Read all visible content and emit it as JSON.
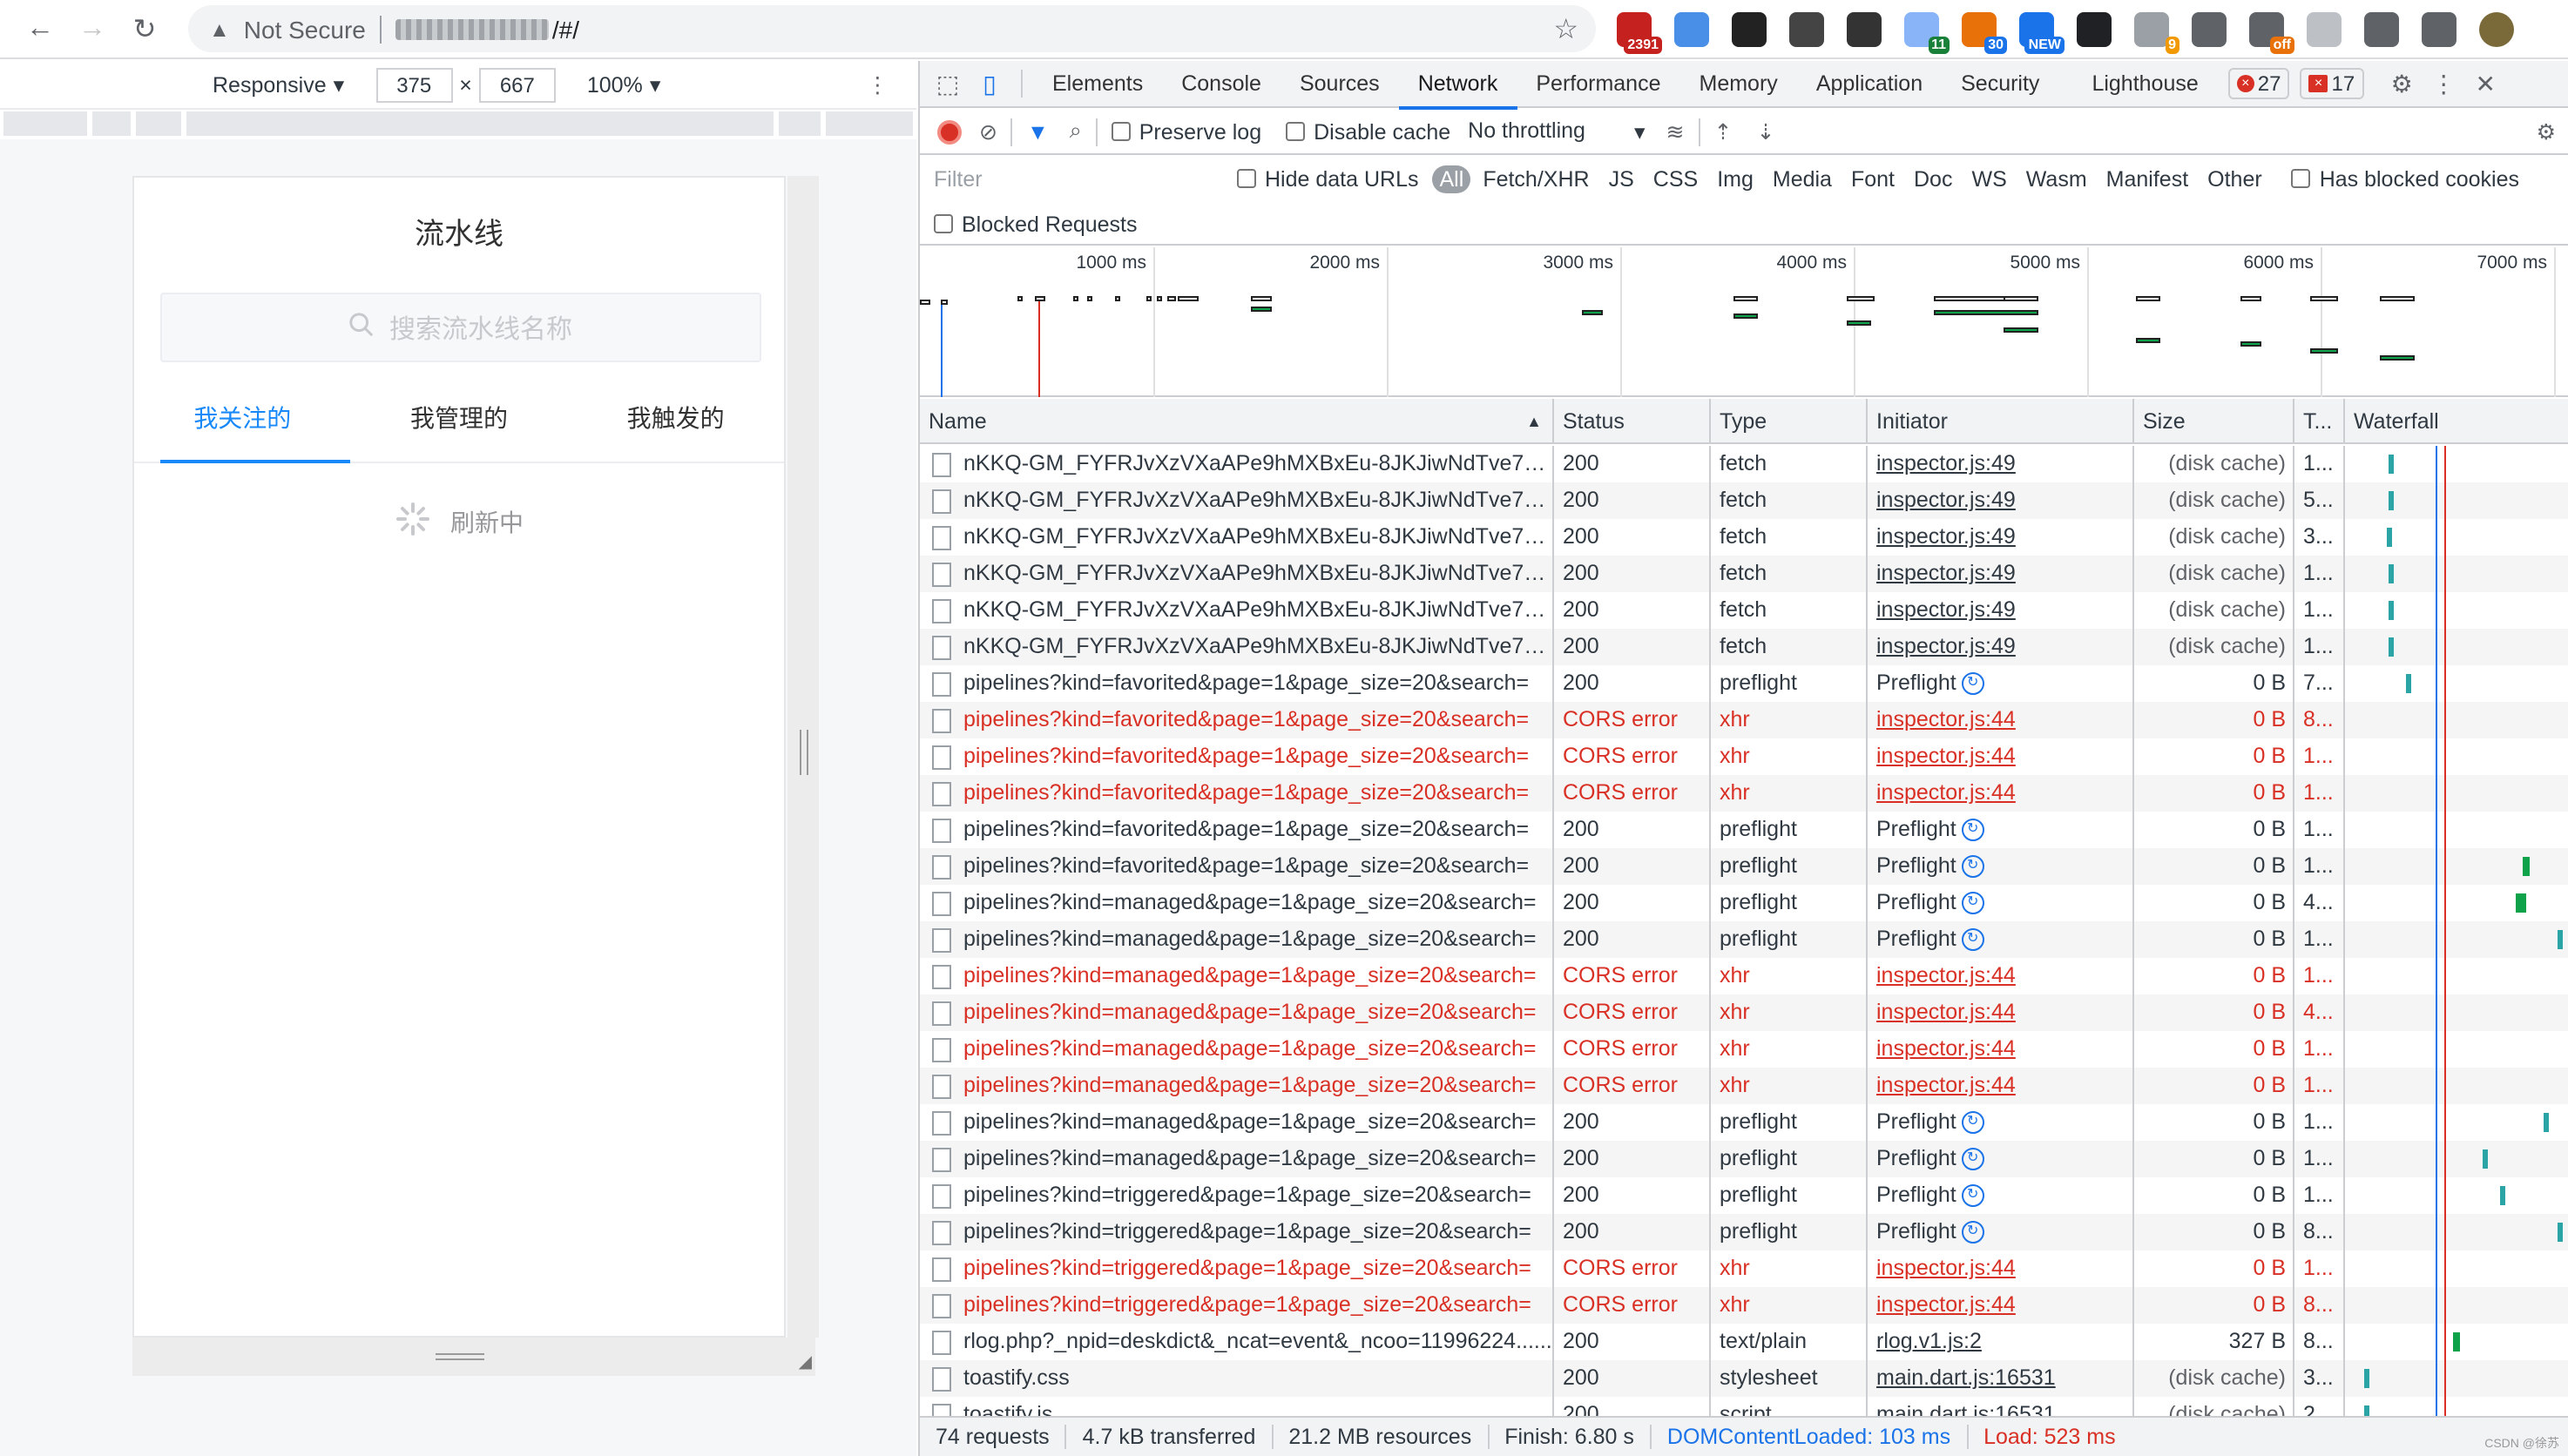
{
  "browser": {
    "security_label": "Not Secure",
    "url_suffix": "/#/",
    "extensions": [
      {
        "name": "gmail-ext-icon",
        "color": "#c5221f",
        "badge": "2391",
        "badge_color": "#c5221f"
      },
      {
        "name": "safari-ext-icon",
        "color": "#4a8fe7",
        "badge": ""
      },
      {
        "name": "spy-ext-icon",
        "color": "#222222",
        "badge": ""
      },
      {
        "name": "h1-ext-icon",
        "color": "#444444",
        "badge": ""
      },
      {
        "name": "square-ext-icon",
        "color": "#333333",
        "badge": ""
      },
      {
        "name": "copy-ext-icon",
        "color": "#8ab4f8",
        "badge": "11",
        "badge_color": "#188038"
      },
      {
        "name": "tile-ext-icon",
        "color": "#e8710a",
        "badge": "30",
        "badge_color": "#1a73e8"
      },
      {
        "name": "new-ext-icon",
        "color": "#1a73e8",
        "badge": "NEW",
        "badge_color": "#1a73e8"
      },
      {
        "name": "mask-ext-icon",
        "color": "#202124",
        "badge": ""
      },
      {
        "name": "circle-ext-icon",
        "color": "#9aa0a6",
        "badge": "9",
        "badge_color": "#f29900"
      },
      {
        "name": "globe-ext-icon",
        "color": "#5f6368",
        "badge": ""
      },
      {
        "name": "off-ext-icon",
        "color": "#5f6368",
        "badge": "off",
        "badge_color": "#e8710a"
      },
      {
        "name": "a-ext-icon",
        "color": "#bdc1c6",
        "badge": ""
      },
      {
        "name": "bracket-ext-icon",
        "color": "#5f6368",
        "badge": ""
      },
      {
        "name": "puzzle-ext-icon",
        "color": "#5f6368",
        "badge": ""
      },
      {
        "name": "profile-avatar-icon",
        "color": "#7a6a3a",
        "badge": ""
      }
    ]
  },
  "device": {
    "mode": "Responsive",
    "width": "375",
    "height": "667",
    "times": "×",
    "zoom": "100%"
  },
  "app": {
    "title": "流水线",
    "search_placeholder": "搜索流水线名称",
    "tabs": [
      "我关注的",
      "我管理的",
      "我触发的"
    ],
    "active_tab": 0,
    "loading_text": "刷新中"
  },
  "devtools": {
    "tabs": [
      "Elements",
      "Console",
      "Sources",
      "Network",
      "Performance",
      "Memory",
      "Application",
      "Security",
      "Lighthouse"
    ],
    "active_tab": "Network",
    "error_count": "27",
    "warning_count": "17",
    "toolbar": {
      "preserve_log": "Preserve log",
      "disable_cache": "Disable cache",
      "throttling": "No throttling"
    },
    "filter": {
      "placeholder": "Filter",
      "hide_data_urls": "Hide data URLs",
      "types": [
        "All",
        "Fetch/XHR",
        "JS",
        "CSS",
        "Img",
        "Media",
        "Font",
        "Doc",
        "WS",
        "Wasm",
        "Manifest",
        "Other"
      ],
      "has_blocked_cookies": "Has blocked cookies",
      "blocked_requests": "Blocked Requests"
    },
    "overview_ticks": [
      "1000 ms",
      "2000 ms",
      "3000 ms",
      "4000 ms",
      "5000 ms",
      "6000 ms",
      "7000 ms"
    ],
    "columns": [
      "Name",
      "Status",
      "Type",
      "Initiator",
      "Size",
      "T...",
      "Waterfall"
    ],
    "rows": [
      {
        "name": "nKKQ-GM_FYFRJvXzVXaAPe9hMXBxEu-8JKJiwNdTve7W4...",
        "status": "200",
        "type": "fetch",
        "initiator": "inspector.js:49",
        "init_kind": "link",
        "size": "(disk cache)",
        "time": "1...",
        "err": false,
        "wf": [
          {
            "pos": 0.2,
            "kind": "t"
          }
        ]
      },
      {
        "name": "nKKQ-GM_FYFRJvXzVXaAPe9hMXBxEu-8JKJiwNdTve7W4...",
        "status": "200",
        "type": "fetch",
        "initiator": "inspector.js:49",
        "init_kind": "link",
        "size": "(disk cache)",
        "time": "5...",
        "err": false,
        "wf": [
          {
            "pos": 0.2,
            "kind": "t"
          }
        ]
      },
      {
        "name": "nKKQ-GM_FYFRJvXzVXaAPe9hMXBxEu-8JKJiwNdTve7W4...",
        "status": "200",
        "type": "fetch",
        "initiator": "inspector.js:49",
        "init_kind": "link",
        "size": "(disk cache)",
        "time": "3...",
        "err": false,
        "wf": [
          {
            "pos": 0.19,
            "kind": "t"
          }
        ]
      },
      {
        "name": "nKKQ-GM_FYFRJvXzVXaAPe9hMXBxEu-8JKJiwNdTve7W4...",
        "status": "200",
        "type": "fetch",
        "initiator": "inspector.js:49",
        "init_kind": "link",
        "size": "(disk cache)",
        "time": "1...",
        "err": false,
        "wf": [
          {
            "pos": 0.2,
            "kind": "t"
          }
        ]
      },
      {
        "name": "nKKQ-GM_FYFRJvXzVXaAPe9hMXBxEu-8JKJiwNdTve7W4...",
        "status": "200",
        "type": "fetch",
        "initiator": "inspector.js:49",
        "init_kind": "link",
        "size": "(disk cache)",
        "time": "1...",
        "err": false,
        "wf": [
          {
            "pos": 0.2,
            "kind": "t"
          }
        ]
      },
      {
        "name": "nKKQ-GM_FYFRJvXzVXaAPe9hMXBxEu-8JKJiwNdTve7W4...",
        "status": "200",
        "type": "fetch",
        "initiator": "inspector.js:49",
        "init_kind": "link",
        "size": "(disk cache)",
        "time": "1...",
        "err": false,
        "wf": [
          {
            "pos": 0.2,
            "kind": "t"
          }
        ]
      },
      {
        "name": "pipelines?kind=favorited&page=1&page_size=20&search=",
        "status": "200",
        "type": "preflight",
        "initiator": "Preflight",
        "init_kind": "preflight",
        "size": "0 B",
        "time": "7...",
        "err": false,
        "wf": [
          {
            "pos": 0.28,
            "kind": "t"
          }
        ]
      },
      {
        "name": "pipelines?kind=favorited&page=1&page_size=20&search=",
        "status": "CORS error",
        "type": "xhr",
        "initiator": "inspector.js:44",
        "init_kind": "link",
        "size": "0 B",
        "time": "8...",
        "err": true,
        "wf": []
      },
      {
        "name": "pipelines?kind=favorited&page=1&page_size=20&search=",
        "status": "CORS error",
        "type": "xhr",
        "initiator": "inspector.js:44",
        "init_kind": "link",
        "size": "0 B",
        "time": "1...",
        "err": true,
        "wf": []
      },
      {
        "name": "pipelines?kind=favorited&page=1&page_size=20&search=",
        "status": "CORS error",
        "type": "xhr",
        "initiator": "inspector.js:44",
        "init_kind": "link",
        "size": "0 B",
        "time": "1...",
        "err": true,
        "wf": []
      },
      {
        "name": "pipelines?kind=favorited&page=1&page_size=20&search=",
        "status": "200",
        "type": "preflight",
        "initiator": "Preflight",
        "init_kind": "preflight",
        "size": "0 B",
        "time": "1...",
        "err": false,
        "wf": []
      },
      {
        "name": "pipelines?kind=favorited&page=1&page_size=20&search=",
        "status": "200",
        "type": "preflight",
        "initiator": "Preflight",
        "init_kind": "preflight",
        "size": "0 B",
        "time": "1...",
        "err": false,
        "wf": [
          {
            "pos": 0.82,
            "kind": "g"
          }
        ]
      },
      {
        "name": "pipelines?kind=managed&page=1&page_size=20&search=",
        "status": "200",
        "type": "preflight",
        "initiator": "Preflight",
        "init_kind": "preflight",
        "size": "0 B",
        "time": "4...",
        "err": false,
        "wf": [
          {
            "pos": 0.79,
            "kind": "g"
          },
          {
            "pos": 0.81,
            "kind": "g"
          }
        ]
      },
      {
        "name": "pipelines?kind=managed&page=1&page_size=20&search=",
        "status": "200",
        "type": "preflight",
        "initiator": "Preflight",
        "init_kind": "preflight",
        "size": "0 B",
        "time": "1...",
        "err": false,
        "wf": [
          {
            "pos": 0.98,
            "kind": "t"
          }
        ]
      },
      {
        "name": "pipelines?kind=managed&page=1&page_size=20&search=",
        "status": "CORS error",
        "type": "xhr",
        "initiator": "inspector.js:44",
        "init_kind": "link",
        "size": "0 B",
        "time": "1...",
        "err": true,
        "wf": []
      },
      {
        "name": "pipelines?kind=managed&page=1&page_size=20&search=",
        "status": "CORS error",
        "type": "xhr",
        "initiator": "inspector.js:44",
        "init_kind": "link",
        "size": "0 B",
        "time": "4...",
        "err": true,
        "wf": []
      },
      {
        "name": "pipelines?kind=managed&page=1&page_size=20&search=",
        "status": "CORS error",
        "type": "xhr",
        "initiator": "inspector.js:44",
        "init_kind": "link",
        "size": "0 B",
        "time": "1...",
        "err": true,
        "wf": []
      },
      {
        "name": "pipelines?kind=managed&page=1&page_size=20&search=",
        "status": "CORS error",
        "type": "xhr",
        "initiator": "inspector.js:44",
        "init_kind": "link",
        "size": "0 B",
        "time": "1...",
        "err": true,
        "wf": []
      },
      {
        "name": "pipelines?kind=managed&page=1&page_size=20&search=",
        "status": "200",
        "type": "preflight",
        "initiator": "Preflight",
        "init_kind": "preflight",
        "size": "0 B",
        "time": "1...",
        "err": false,
        "wf": [
          {
            "pos": 0.92,
            "kind": "t"
          }
        ]
      },
      {
        "name": "pipelines?kind=managed&page=1&page_size=20&search=",
        "status": "200",
        "type": "preflight",
        "initiator": "Preflight",
        "init_kind": "preflight",
        "size": "0 B",
        "time": "1...",
        "err": false,
        "wf": [
          {
            "pos": 0.64,
            "kind": "t"
          }
        ]
      },
      {
        "name": "pipelines?kind=triggered&page=1&page_size=20&search=",
        "status": "200",
        "type": "preflight",
        "initiator": "Preflight",
        "init_kind": "preflight",
        "size": "0 B",
        "time": "1...",
        "err": false,
        "wf": [
          {
            "pos": 0.72,
            "kind": "t"
          }
        ]
      },
      {
        "name": "pipelines?kind=triggered&page=1&page_size=20&search=",
        "status": "200",
        "type": "preflight",
        "initiator": "Preflight",
        "init_kind": "preflight",
        "size": "0 B",
        "time": "8...",
        "err": false,
        "wf": [
          {
            "pos": 0.98,
            "kind": "t"
          }
        ]
      },
      {
        "name": "pipelines?kind=triggered&page=1&page_size=20&search=",
        "status": "CORS error",
        "type": "xhr",
        "initiator": "inspector.js:44",
        "init_kind": "link",
        "size": "0 B",
        "time": "1...",
        "err": true,
        "wf": []
      },
      {
        "name": "pipelines?kind=triggered&page=1&page_size=20&search=",
        "status": "CORS error",
        "type": "xhr",
        "initiator": "inspector.js:44",
        "init_kind": "link",
        "size": "0 B",
        "time": "8...",
        "err": true,
        "wf": []
      },
      {
        "name": "rlog.php?_npid=deskdict&_ncat=event&_ncoo=11996224......",
        "status": "200",
        "type": "text/plain",
        "initiator": "rlog.v1.js:2",
        "init_kind": "link",
        "size": "327 B",
        "time": "8...",
        "err": false,
        "wf": [
          {
            "pos": 0.5,
            "kind": "g"
          }
        ]
      },
      {
        "name": "toastify.css",
        "status": "200",
        "type": "stylesheet",
        "initiator": "main.dart.js:16531",
        "init_kind": "link",
        "size": "(disk cache)",
        "time": "3...",
        "err": false,
        "wf": [
          {
            "pos": 0.09,
            "kind": "t"
          }
        ]
      },
      {
        "name": "toastify.js",
        "status": "200",
        "type": "script",
        "initiator": "main.dart.js:16531",
        "init_kind": "link",
        "size": "(disk cache)",
        "time": "2...",
        "err": false,
        "wf": [
          {
            "pos": 0.09,
            "kind": "t"
          }
        ]
      }
    ],
    "status_bar": {
      "requests": "74 requests",
      "transferred": "4.7 kB transferred",
      "resources": "21.2 MB resources",
      "finish": "Finish: 6.80 s",
      "dom_loaded": "DOMContentLoaded: 103 ms",
      "load": "Load: 523 ms"
    },
    "watermark": "CSDN @徐苏"
  }
}
